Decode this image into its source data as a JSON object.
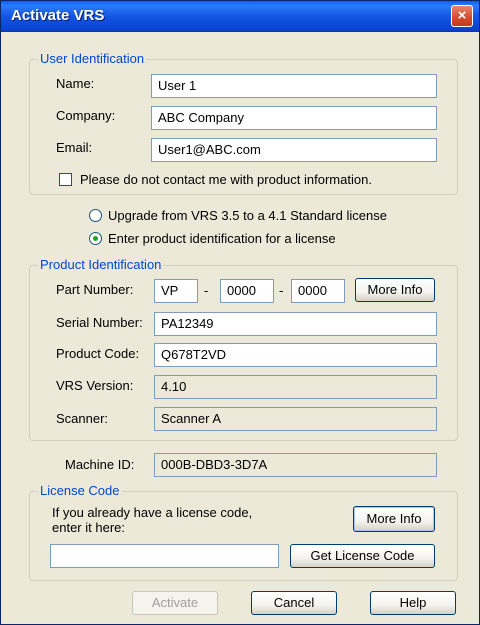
{
  "window": {
    "title": "Activate VRS",
    "close_glyph": "×"
  },
  "user_identification": {
    "legend": "User Identification",
    "name_label": "Name:",
    "name_value": "User 1",
    "company_label": "Company:",
    "company_value": "ABC Company",
    "email_label": "Email:",
    "email_value": "User1@ABC.com",
    "no_contact_label": "Please do not contact me with product information.",
    "no_contact_checked": false
  },
  "license_options": {
    "upgrade_label": "Upgrade from VRS 3.5 to a 4.1 Standard license",
    "enter_label": "Enter product identification for a license",
    "selected": "enter"
  },
  "product_identification": {
    "legend": "Product Identification",
    "part_number_label": "Part Number:",
    "part_1": "VP",
    "part_2": "0000",
    "part_3": "0000",
    "separator": "-",
    "more_info_label": "More Info",
    "serial_number_label": "Serial Number:",
    "serial_number_value": "PA12349",
    "product_code_label": "Product Code:",
    "product_code_value": "Q678T2VD",
    "vrs_version_label": "VRS Version:",
    "vrs_version_value": "4.10",
    "scanner_label": "Scanner:",
    "scanner_value": "Scanner A"
  },
  "machine": {
    "label": "Machine ID:",
    "value": "000B-DBD3-3D7A"
  },
  "license_code": {
    "legend": "License Code",
    "instruction_line1": "If you already have a license code,",
    "instruction_line2": "enter it here:",
    "more_info_label": "More Info",
    "code_value": "",
    "get_license_label": "Get License Code"
  },
  "footer": {
    "activate_label": "Activate",
    "cancel_label": "Cancel",
    "help_label": "Help"
  },
  "colors": {
    "titlebar": "#0a5ef5",
    "legend_text": "#0046d5",
    "dialog_bg": "#ece9d8",
    "close_button": "#d34a2c",
    "radio_dot": "#21a121"
  }
}
